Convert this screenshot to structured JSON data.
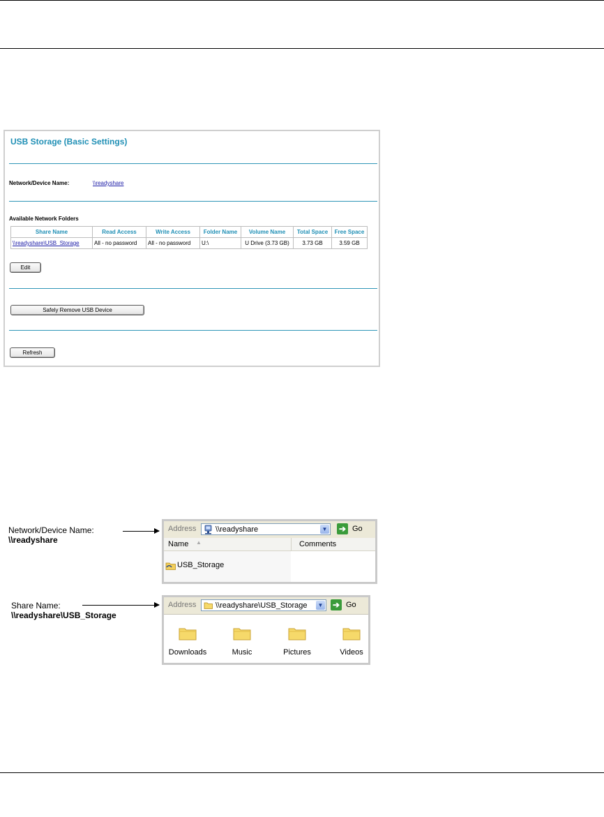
{
  "panel": {
    "title": "USB Storage (Basic Settings)",
    "device_label": "Network/Device Name:",
    "device_value": "\\\\readyshare",
    "folders_heading": "Available Network Folders",
    "table": {
      "headers": [
        "Share Name",
        "Read Access",
        "Write Access",
        "Folder Name",
        "Volume Name",
        "Total Space",
        "Free Space"
      ],
      "rows": [
        [
          "\\\\readyshare\\USB_Storage",
          "All - no password",
          "All - no password",
          "U:\\",
          "U Drive (3.73 GB)",
          "3.73 GB",
          "3.59 GB"
        ]
      ]
    },
    "edit_label": "Edit",
    "remove_label": "Safely Remove USB Device",
    "refresh_label": "Refresh"
  },
  "callout1": {
    "line1": "Network/Device Name:",
    "line2": "\\\\readyshare"
  },
  "callout2": {
    "line1": "Share Name:",
    "line2": "\\\\readyshare\\USB_Storage"
  },
  "win1": {
    "address_label": "Address",
    "address_value": "\\\\readyshare",
    "go_label": "Go",
    "col_name": "Name",
    "col_comments": "Comments",
    "item": "USB_Storage"
  },
  "win2": {
    "address_label": "Address",
    "address_value": "\\\\readyshare\\USB_Storage",
    "go_label": "Go",
    "folders": [
      "Downloads",
      "Music",
      "Pictures",
      "Videos"
    ]
  },
  "colors": {
    "accent": "#1f8fb5",
    "link": "#1a1aa6",
    "folder": "#f6d96a"
  }
}
